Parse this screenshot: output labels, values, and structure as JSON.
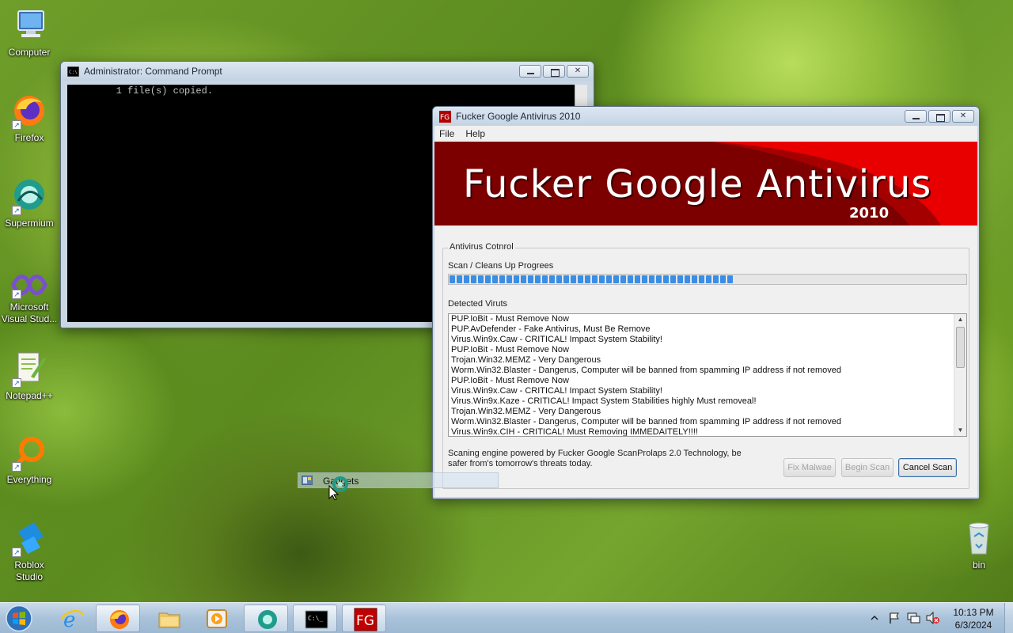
{
  "desktop": {
    "icons": [
      {
        "label": "Computer",
        "icon": "computer-icon"
      },
      {
        "label": "Firefox",
        "icon": "firefox-icon"
      },
      {
        "label": "Supermium",
        "icon": "supermium-icon"
      },
      {
        "label": "Microsoft Visual Stud...",
        "icon": "visual-studio-icon"
      },
      {
        "label": "Notepad++",
        "icon": "notepad-plus-plus-icon"
      },
      {
        "label": "Everything",
        "icon": "everything-icon"
      },
      {
        "label": "Roblox Studio",
        "icon": "roblox-studio-icon"
      },
      {
        "label": "bin",
        "icon": "recycle-bin-icon"
      }
    ]
  },
  "cmd": {
    "title": "Administrator:  Command Prompt",
    "output": "        1 file(s) copied."
  },
  "av": {
    "title": "Fucker Google Antivirus 2010",
    "menu": [
      "File",
      "Help"
    ],
    "banner_title": "Fucker Google Antivirus",
    "banner_year": "2010",
    "group_title": "Antivirus Cotnrol",
    "progress_label": "Scan / Cleans Up Progrees",
    "progress_fraction": 0.56,
    "list_label": "Detected Viruts",
    "detections": [
      "PUP.IoBit - Must Remove Now",
      "PUP.AvDefender - Fake Antivirus, Must Be Remove",
      "Virus.Win9x.Caw - CRITICAL! Impact System Stability!",
      "PUP.IoBit - Must Remove Now",
      "Trojan.Win32.MEMZ - Very Dangerous",
      "Worm.Win32.Blaster - Dangerus, Computer will be banned from spamming IP address if not removed",
      "PUP.IoBit - Must Remove Now",
      "Virus.Win9x.Caw - CRITICAL! Impact System Stability!",
      "Virus.Win9x.Kaze - CRITICAL! Impact System Stabilities highly Must removeal!",
      "Trojan.Win32.MEMZ - Very Dangerous",
      "Worm.Win32.Blaster - Dangerus, Computer will be banned from spamming IP address if not removed",
      "Virus.Win9x.CIH - CRITICAL! Must Removing IMMEDAITELY!!!!"
    ],
    "footer_text": "Scaning engine powered by Fucker Google ScanProlaps 2.0 Technology, be safer from's tomorrow's threats today.",
    "buttons": {
      "fix": "Fix Malwae",
      "begin": "Begin Scan",
      "cancel": "Cancel Scan"
    }
  },
  "gadgets": {
    "label": "Gadgets"
  },
  "taskbar": {
    "items": [
      "internet-explorer-icon",
      "firefox-icon",
      "file-explorer-icon",
      "media-player-icon",
      "supermium-icon",
      "command-prompt-icon",
      "fucker-google-antivirus-icon"
    ],
    "time": "10:13 PM",
    "date": "6/3/2024"
  },
  "colors": {
    "banner_dark_red": "#7c0000",
    "banner_red": "#e80000",
    "progress_blue": "#3a8ee6"
  }
}
